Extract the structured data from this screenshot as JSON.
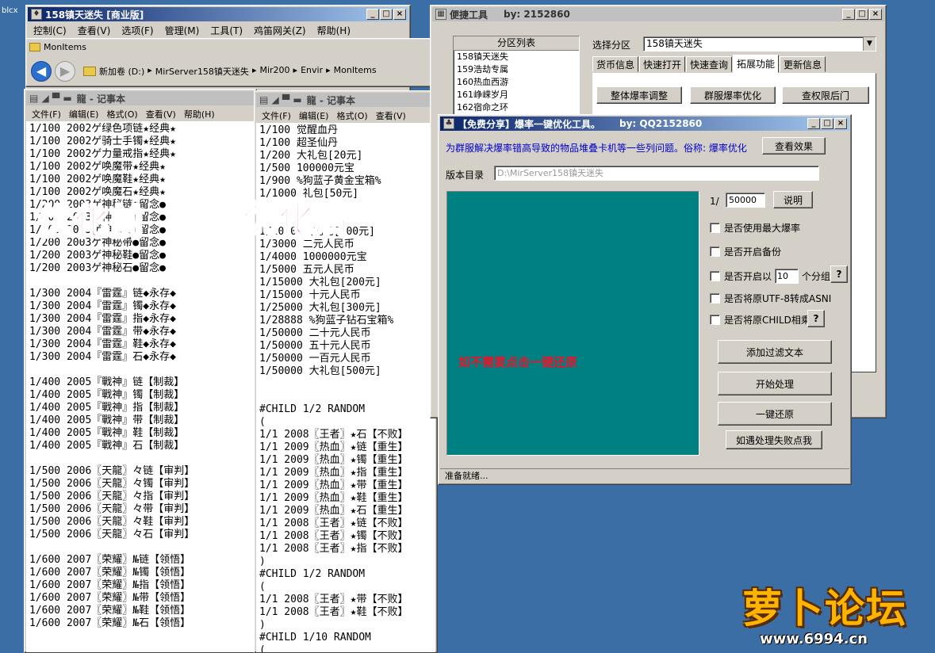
{
  "desktop": {
    "corner_text": "blcx"
  },
  "main_window": {
    "title": "158镇天迷失 [商业版]",
    "menu": [
      "控制(C)",
      "查看(V)",
      "选项(F)",
      "管理(M)",
      "工具(T)",
      "鸡笛网关(Z)",
      "帮助(H)"
    ]
  },
  "explorer": {
    "title": "MonItems",
    "path": [
      "新加卷 (D:)",
      "MirServer158镇天迷失",
      "Mir200",
      "Envir",
      "MonItems"
    ]
  },
  "notepad_left": {
    "title": "龍 - 记事本",
    "menu": [
      "文件(F)",
      "编辑(E)",
      "格式(O)",
      "查看(V)",
      "帮助(H)"
    ],
    "lines": [
      "1/100 2002ゲ绿色项链★经典★",
      "1/100 2002ゲ骑士手镯★经典★",
      "1/100 2002ゲ力量戒指★经典★",
      "1/100 2002ゲ唤魔带★经典★",
      "1/100 2002ゲ唤魔鞋★经典★",
      "1/100 2002ゲ唤魔石★经典★",
      "1/200 2003ゲ神秘链●留念●",
      "1/200 2003ゲ神秘镯●留念●",
      "1/200 2003ゲ神秘戒●留念●",
      "1/200 2003ゲ神秘带●留念●",
      "1/200 2003ゲ神秘鞋●留念●",
      "1/200 2003ゲ神秘石●留念●",
      "",
      "1/300 2004『雷霆』链◆永存◆",
      "1/300 2004『雷霆』镯◆永存◆",
      "1/300 2004『雷霆』指◆永存◆",
      "1/300 2004『雷霆』带◆永存◆",
      "1/300 2004『雷霆』鞋◆永存◆",
      "1/300 2004『雷霆』石◆永存◆",
      "",
      "1/400 2005『戰神』链【制裁】",
      "1/400 2005『戰神』镯【制裁】",
      "1/400 2005『戰神』指【制裁】",
      "1/400 2005『戰神』带【制裁】",
      "1/400 2005『戰神』鞋【制裁】",
      "1/400 2005『戰神』石【制裁】",
      "",
      "1/500 2006〖天龍〗々链【审判】",
      "1/500 2006〖天龍〗々镯【审判】",
      "1/500 2006〖天龍〗々指【审判】",
      "1/500 2006〖天龍〗々带【审判】",
      "1/500 2006〖天龍〗々鞋【审判】",
      "1/500 2006〖天龍〗々石【审判】",
      "",
      "1/600 2007〖荣耀〗№链【领悟】",
      "1/600 2007〖荣耀〗№镯【领悟】",
      "1/600 2007〖荣耀〗№指【领悟】",
      "1/600 2007〖荣耀〗№带【领悟】",
      "1/600 2007〖荣耀〗№鞋【领悟】",
      "1/600 2007〖荣耀〗№石【领悟】"
    ]
  },
  "notepad_right": {
    "title": "龍 - 记事本",
    "menu": [
      "文件(F)",
      "编辑(E)",
      "格式(O)",
      "查看(V)"
    ],
    "lines": [
      "1/100 觉醒血丹",
      "1/100 超圣仙丹",
      "1/200 大礼包[20元]",
      "1/500 100000元宝",
      "1/900 %狗蓝子黄金宝箱%",
      "1/1000 礼包[50元]",
      "",
      "",
      "1/2000 大礼包[100元]",
      "1/3000 二元人民币",
      "1/4000 1000000元宝",
      "1/5000 五元人民币",
      "1/15000 大礼包[200元]",
      "1/15000 十元人民币",
      "1/25000 大礼包[300元]",
      "1/28888 %狗蓝子钻石宝箱%",
      "1/50000 二十元人民币",
      "1/50000 五十元人民币",
      "1/50000 一百元人民币",
      "1/50000 大礼包[500元]",
      "",
      "",
      "#CHILD 1/2 RANDOM",
      "(",
      "1/1 2008〖王者〗★石【不败】",
      "1/1 2009〖热血〗★链【重生】",
      "1/1 2009〖热血〗★镯【重生】",
      "1/1 2009〖热血〗★指【重生】",
      "1/1 2009〖热血〗★带【重生】",
      "1/1 2009〖热血〗★鞋【重生】",
      "1/1 2009〖热血〗★石【重生】",
      "1/1 2008〖王者〗★链【不败】",
      "1/1 2008〖王者〗★镯【不败】",
      "1/1 2008〖王者〗★指【不败】",
      ")",
      "#CHILD 1/2 RANDOM",
      "(",
      "1/1 2008〖王者〗★带【不败】",
      "1/1 2008〖王者〗★鞋【不败】",
      ")",
      "#CHILD 1/10 RANDOM",
      "("
    ]
  },
  "labels": {
    "before": "优化前",
    "after": "优化后"
  },
  "quick_tool": {
    "title": "便捷工具",
    "author": "by: 2152860",
    "partition_list_header": "分区列表",
    "partitions": [
      "158镇天迷失",
      "159浩劫专属",
      "160热血西游",
      "161峥嵘岁月",
      "162宿命之环"
    ],
    "select_label": "选择分区",
    "select_value": "158镇天迷失",
    "tabs": [
      "货币信息",
      "快速打开",
      "快速查询",
      "拓展功能",
      "更新信息"
    ],
    "active_tab_index": 3,
    "buttons": [
      "整体爆率调整",
      "群服爆率优化",
      "查权限后门"
    ]
  },
  "optimizer": {
    "title": "【免费分享】爆率一键优化工具。",
    "author": "by: QQ2152860",
    "description": "为群服解决爆率错高导致的物品堆叠卡机等一些列问题。俗称: 爆率优化",
    "view_effect_button": "查看效果",
    "dir_label": "版本目录",
    "dir_value": "D:\\MirServer158镇天迷失",
    "ratio_prefix": "1/",
    "ratio_value": "50000",
    "explain_button": "说明",
    "opt_max_rate": "是否使用最大爆率",
    "opt_backup": "是否开启备份",
    "opt_group_prefix": "是否开启以",
    "opt_group_value": "10",
    "opt_group_suffix": "个分组",
    "opt_utf8": "是否将原UTF-8转成ASNI",
    "opt_child": "是否将原CHILD相乘",
    "help_label": "?",
    "panel_message": "如不需要点击一键还原",
    "add_filter_button": "添加过滤文本",
    "start_button": "开始处理",
    "restore_button": "一键还原",
    "fail_button": "如遇处理失败点我",
    "status": "准备就绪...",
    "panel_color": "#008080",
    "message_color": "#e8142d"
  },
  "watermark": {
    "title": "萝卜论坛",
    "url": "www.6994.cn"
  }
}
